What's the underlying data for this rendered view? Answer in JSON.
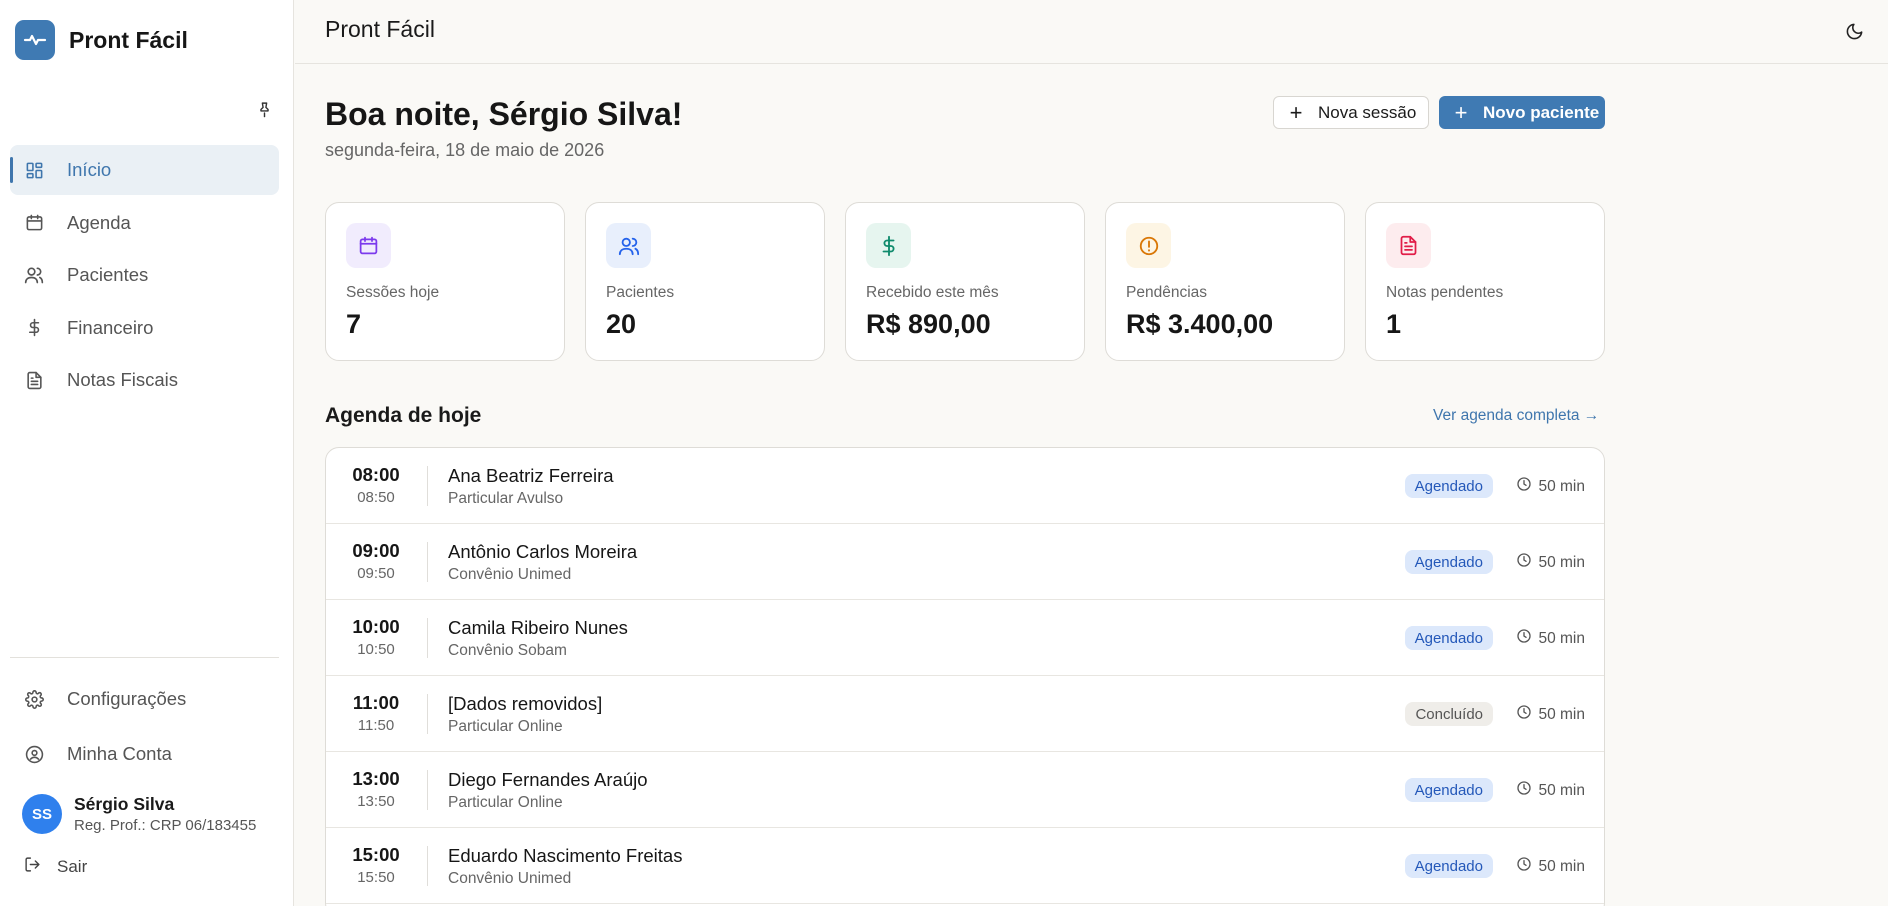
{
  "app": {
    "name": "Pront Fácil"
  },
  "sidebar": {
    "items": [
      {
        "label": "Início",
        "icon": "dashboard-icon",
        "active": true
      },
      {
        "label": "Agenda",
        "icon": "calendar-icon"
      },
      {
        "label": "Pacientes",
        "icon": "users-icon"
      },
      {
        "label": "Financeiro",
        "icon": "dollar-icon"
      },
      {
        "label": "Notas Fiscais",
        "icon": "file-text-icon"
      }
    ],
    "bottom_items": [
      {
        "label": "Configurações",
        "icon": "gear-icon"
      },
      {
        "label": "Minha Conta",
        "icon": "user-circle-icon"
      }
    ],
    "user": {
      "initials": "SS",
      "name": "Sérgio Silva",
      "reg": "Reg. Prof.: CRP 06/183455"
    },
    "logout_label": "Sair"
  },
  "topbar": {
    "title": "Pront Fácil"
  },
  "main": {
    "greeting": "Boa noite, Sérgio Silva!",
    "date": "segunda-feira, 18 de maio de 2026",
    "new_session_label": "Nova sessão",
    "new_patient_label": "Novo paciente",
    "stats": [
      {
        "label": "Sessões hoje",
        "value": "7",
        "icon": "calendar-icon",
        "color": "#7c3aed",
        "bg": "#f1ecfd"
      },
      {
        "label": "Pacientes",
        "value": "20",
        "icon": "users-icon",
        "color": "#2563eb",
        "bg": "#e8effc"
      },
      {
        "label": "Recebido este mês",
        "value": "R$ 890,00",
        "icon": "dollar-icon",
        "color": "#0f8a6c",
        "bg": "#e6f5ef"
      },
      {
        "label": "Pendências",
        "value": "R$ 3.400,00",
        "icon": "alert-circle-icon",
        "color": "#d97706",
        "bg": "#fdf5e4"
      },
      {
        "label": "Notas pendentes",
        "value": "1",
        "icon": "file-text-icon",
        "color": "#e11d48",
        "bg": "#fdecee"
      }
    ],
    "agenda_title": "Agenda de hoje",
    "see_all_label": "Ver agenda completa →",
    "appointments": [
      {
        "start": "08:00",
        "end": "08:50",
        "name": "Ana Beatriz Ferreira",
        "type": "Particular Avulso",
        "status": "Agendado",
        "duration": "50 min"
      },
      {
        "start": "09:00",
        "end": "09:50",
        "name": "Antônio Carlos Moreira",
        "type": "Convênio Unimed",
        "status": "Agendado",
        "duration": "50 min"
      },
      {
        "start": "10:00",
        "end": "10:50",
        "name": "Camila Ribeiro Nunes",
        "type": "Convênio Sobam",
        "status": "Agendado",
        "duration": "50 min"
      },
      {
        "start": "11:00",
        "end": "11:50",
        "name": "[Dados removidos]",
        "type": "Particular Online",
        "status": "Concluído",
        "duration": "50 min"
      },
      {
        "start": "13:00",
        "end": "13:50",
        "name": "Diego Fernandes Araújo",
        "type": "Particular Online",
        "status": "Agendado",
        "duration": "50 min"
      },
      {
        "start": "15:00",
        "end": "15:50",
        "name": "Eduardo Nascimento Freitas",
        "type": "Convênio Unimed",
        "status": "Agendado",
        "duration": "50 min"
      }
    ]
  }
}
